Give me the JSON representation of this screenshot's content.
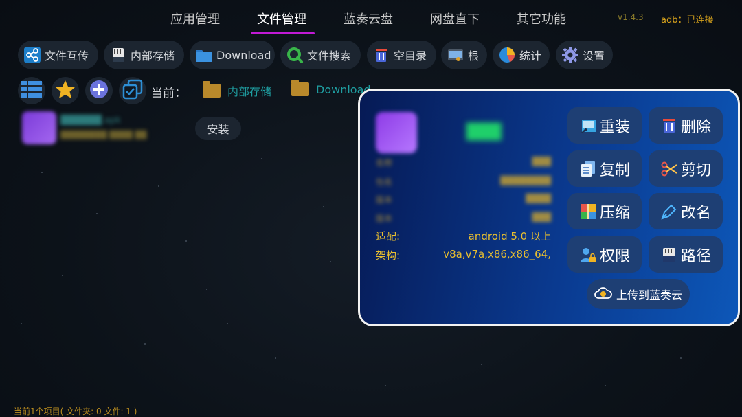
{
  "nav": {
    "tabs": [
      "应用管理",
      "文件管理",
      "蓝奏云盘",
      "网盘直下",
      "其它功能"
    ],
    "active_tab": "文件管理",
    "version": "v1.4.3",
    "adb_status": "adb：已连接"
  },
  "toolbar": {
    "file_transfer": "文件互传",
    "internal_storage": "内部存储",
    "download": "Download",
    "file_search": "文件搜索",
    "empty_dir": "空目录",
    "root": "根",
    "stats": "统计",
    "settings": "设置"
  },
  "path": {
    "current_label": "当前：",
    "crumbs": [
      "内部存储",
      "Download"
    ]
  },
  "file_list": {
    "item_name": "██████.apk",
    "item_meta": "████████ ████ ██",
    "install_label": "安装"
  },
  "popup": {
    "app_title": "███",
    "info_blurred": [
      {
        "label": "名称",
        "value": "███"
      },
      {
        "label": "包名",
        "value": "████████"
      },
      {
        "label": "版本",
        "value": "████"
      },
      {
        "label": "版本",
        "value": "███"
      }
    ],
    "compat_label": "适配:",
    "compat_value": "android 5.0 以上",
    "arch_label": "架构:",
    "arch_value": "v8a,v7a,x86,x86_64,",
    "actions": {
      "reinstall": "重装",
      "delete": "删除",
      "copy": "复制",
      "cut": "剪切",
      "compress": "压缩",
      "rename": "改名",
      "permission": "权限",
      "path": "路径"
    },
    "upload_label": "上传到蓝奏云"
  },
  "status_bar": "当前1个项目( 文件夹: 0  文件: 1 )",
  "colors": {
    "accent_tab": "#c21ad6",
    "crumb_text": "#1f9ea1",
    "warn_text": "#e9bf2f",
    "popup_border": "#f2f2f2"
  }
}
